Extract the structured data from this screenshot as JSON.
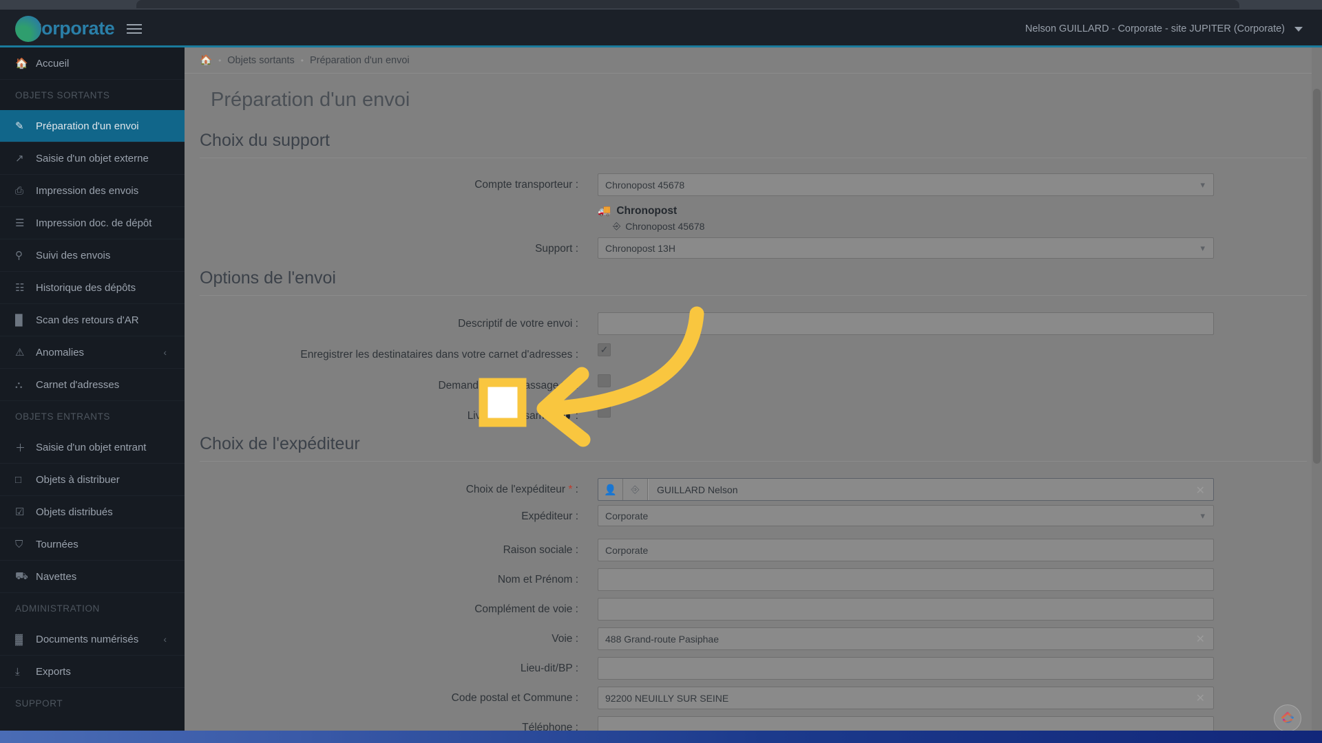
{
  "brand": {
    "lead": "C",
    "rest": "orporate",
    "menu_icon": "hamburger-icon"
  },
  "topbar": {
    "user": "Nelson GUILLARD - Corporate - site JUPITER (Corporate)"
  },
  "sidebar": {
    "home": {
      "label": "Accueil",
      "icon": "home-icon"
    },
    "groups": [
      {
        "heading": "OBJETS SORTANTS",
        "items": [
          {
            "label": "Préparation d'un envoi",
            "icon": "pencil-icon",
            "active": true
          },
          {
            "label": "Saisie d'un objet externe",
            "icon": "external-link-icon"
          },
          {
            "label": "Impression des envois",
            "icon": "printer-icon"
          },
          {
            "label": "Impression doc. de dépôt",
            "icon": "document-icon"
          },
          {
            "label": "Suivi des envois",
            "icon": "search-icon"
          },
          {
            "label": "Historique des dépôts",
            "icon": "calendar-icon"
          },
          {
            "label": "Scan des retours d'AR",
            "icon": "barcode-icon"
          },
          {
            "label": "Anomalies",
            "icon": "warning-icon",
            "chevron": "‹"
          },
          {
            "label": "Carnet d'adresses",
            "icon": "contacts-icon"
          }
        ]
      },
      {
        "heading": "OBJETS ENTRANTS",
        "items": [
          {
            "label": "Saisie d'un objet entrant",
            "icon": "plus-icon"
          },
          {
            "label": "Objets à distribuer",
            "icon": "square-icon"
          },
          {
            "label": "Objets distribués",
            "icon": "check-square-icon"
          },
          {
            "label": "Tournées",
            "icon": "cart-icon"
          },
          {
            "label": "Navettes",
            "icon": "truck-icon"
          }
        ]
      },
      {
        "heading": "ADMINISTRATION",
        "items": [
          {
            "label": "Documents numérisés",
            "icon": "qr-icon",
            "chevron": "‹"
          },
          {
            "label": "Exports",
            "icon": "download-icon"
          }
        ]
      },
      {
        "heading": "SUPPORT",
        "items": []
      }
    ]
  },
  "breadcrumb": {
    "home_icon": "home-icon",
    "items": [
      "Objets sortants",
      "Préparation d'un envoi"
    ],
    "separator": "•"
  },
  "page": {
    "title": "Préparation d'un envoi"
  },
  "sections": {
    "support": {
      "title": "Choix du support",
      "carrier_account_label": "Compte transporteur :",
      "carrier_account_value": "Chronopost 45678",
      "carrier_name": "Chronopost",
      "carrier_name_icon": "truck-icon",
      "carrier_sub": "Chronopost 45678",
      "carrier_sub_icon": "parcel-icon",
      "support_label": "Support :",
      "support_value": "Chronopost 13H"
    },
    "options": {
      "title": "Options de l'envoi",
      "description_label": "Descriptif de votre envoi :",
      "description_value": "",
      "save_recipients_label": "Enregistrer les destinataires dans votre carnet d'adresses :",
      "save_recipients_checked": true,
      "pickup_label": "Demander un ramassage",
      "pickup_checked": false,
      "saturday_label": "Livraison le samedi",
      "saturday_checked": false,
      "label_suffix": " :",
      "info_icon": "info-icon"
    },
    "sender": {
      "title": "Choix de l'expéditeur",
      "choice_label": "Choix de l'expéditeur",
      "choice_required": "*",
      "choice_value": "GUILLARD Nelson",
      "choice_icon_person": "person-icon",
      "choice_icon_parcel": "parcel-icon",
      "expediteur_label": "Expéditeur :",
      "expediteur_value": "Corporate",
      "fields": [
        {
          "label": "Raison sociale :",
          "value": "Corporate",
          "clearable": false
        },
        {
          "label": "Nom et Prénom :",
          "value": "",
          "clearable": false
        },
        {
          "label": "Complément de voie :",
          "value": "",
          "clearable": false
        },
        {
          "label": "Voie :",
          "value": "488 Grand-route Pasiphae",
          "clearable": true
        },
        {
          "label": "Lieu-dit/BP :",
          "value": "",
          "clearable": false
        },
        {
          "label": "Code postal et Commune :",
          "value": "92200 NEUILLY SUR SEINE",
          "clearable": true
        },
        {
          "label": "Téléphone :",
          "value": "",
          "clearable": false
        }
      ]
    }
  },
  "annotation": {
    "highlight_target": "pickup-checkbox",
    "arrow": "curved-left-arrow",
    "color": "#f9c63f"
  },
  "colors": {
    "accent": "#11668a",
    "topbar_bg": "#1b2028",
    "sidebar_bg": "#161b22",
    "content_bg": "#808080",
    "highlight": "#f9c63f",
    "required": "#c0392b"
  },
  "support_widget": {
    "icon": "support-chat-icon"
  }
}
